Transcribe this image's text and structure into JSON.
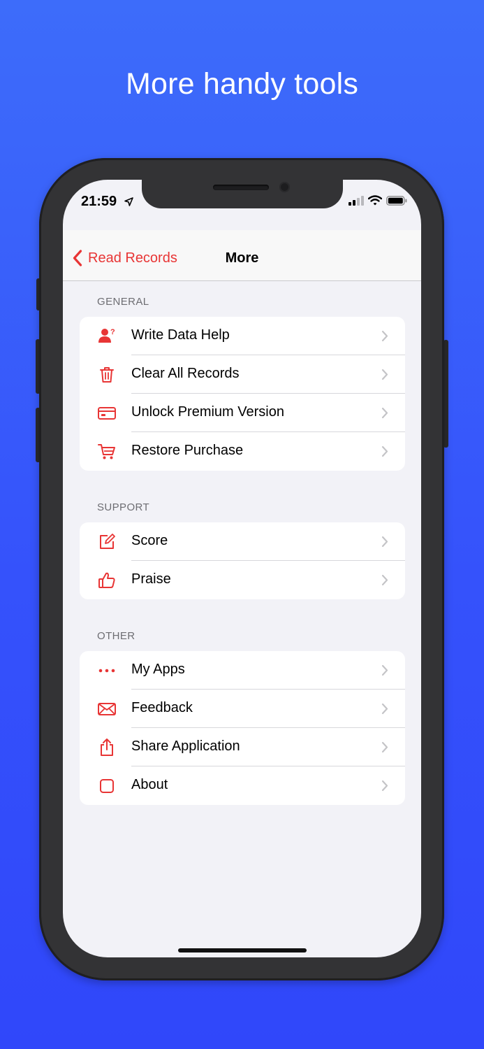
{
  "headline": "More handy tools",
  "status": {
    "time": "21:59"
  },
  "navbar": {
    "back_label": "Read Records",
    "title": "More"
  },
  "accent_color": "#e83535",
  "sections": [
    {
      "header": "GENERAL",
      "items": [
        {
          "label": "Write Data Help",
          "icon": "person-question-icon"
        },
        {
          "label": "Clear All Records",
          "icon": "trash-icon"
        },
        {
          "label": "Unlock Premium Version",
          "icon": "credit-card-icon"
        },
        {
          "label": "Restore Purchase",
          "icon": "cart-icon"
        }
      ]
    },
    {
      "header": "SUPPORT",
      "items": [
        {
          "label": "Score",
          "icon": "edit-icon"
        },
        {
          "label": "Praise",
          "icon": "thumbs-up-icon"
        }
      ]
    },
    {
      "header": "OTHER",
      "items": [
        {
          "label": "My Apps",
          "icon": "more-dots-icon"
        },
        {
          "label": "Feedback",
          "icon": "envelope-icon"
        },
        {
          "label": "Share Application",
          "icon": "share-icon"
        },
        {
          "label": "About",
          "icon": "square-icon"
        }
      ]
    }
  ]
}
